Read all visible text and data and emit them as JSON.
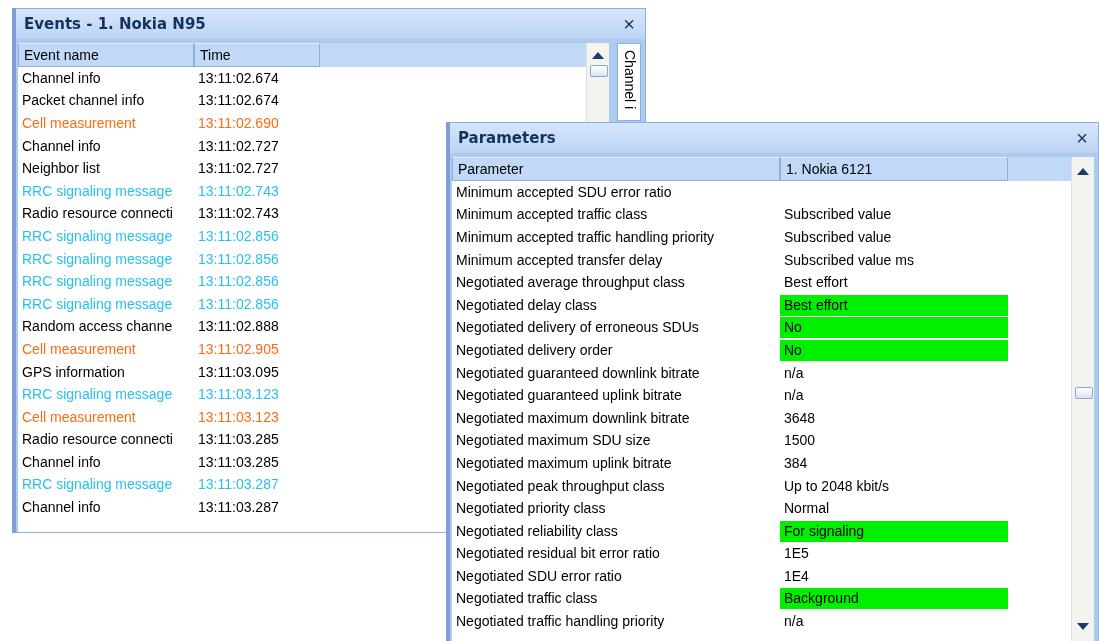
{
  "events_window": {
    "title": "Events - 1. Nokia N95",
    "close": "×",
    "side_tab": "Channel i",
    "columns": [
      "Event name",
      "Time"
    ],
    "rows": [
      {
        "name": "Channel info",
        "time": "13:11:02.674",
        "color": "#000000"
      },
      {
        "name": "Packet channel info",
        "time": "13:11:02.674",
        "color": "#000000"
      },
      {
        "name": "Cell measurement",
        "time": "13:11:02.690",
        "color": "#ff6a13"
      },
      {
        "name": "Channel info",
        "time": "13:11:02.727",
        "color": "#000000"
      },
      {
        "name": "Neighbor list",
        "time": "13:11:02.727",
        "color": "#000000"
      },
      {
        "name": "RRC signaling message",
        "time": "13:11:02.743",
        "color": "#27c0f0"
      },
      {
        "name": "Radio resource connecti",
        "time": "13:11:02.743",
        "color": "#000000"
      },
      {
        "name": "RRC signaling message",
        "time": "13:11:02.856",
        "color": "#27c0f0"
      },
      {
        "name": "RRC signaling message",
        "time": "13:11:02.856",
        "color": "#27c0f0"
      },
      {
        "name": "RRC signaling message",
        "time": "13:11:02.856",
        "color": "#27c0f0"
      },
      {
        "name": "RRC signaling message",
        "time": "13:11:02.856",
        "color": "#27c0f0"
      },
      {
        "name": "Random access channe",
        "time": "13:11:02.888",
        "color": "#000000"
      },
      {
        "name": "Cell measurement",
        "time": "13:11:02.905",
        "color": "#ff6a13"
      },
      {
        "name": "GPS information",
        "time": "13:11:03.095",
        "color": "#000000"
      },
      {
        "name": "RRC signaling message",
        "time": "13:11:03.123",
        "color": "#27c0f0"
      },
      {
        "name": "Cell measurement",
        "time": "13:11:03.123",
        "color": "#ff6a13"
      },
      {
        "name": "Radio resource connecti",
        "time": "13:11:03.285",
        "color": "#000000"
      },
      {
        "name": "Channel info",
        "time": "13:11:03.285",
        "color": "#000000"
      },
      {
        "name": "RRC signaling message",
        "time": "13:11:03.287",
        "color": "#27c0f0"
      },
      {
        "name": "Channel info",
        "time": "13:11:03.287",
        "color": "#000000"
      }
    ]
  },
  "parameters_window": {
    "title": "Parameters",
    "close": "×",
    "columns": [
      "Parameter",
      "1. Nokia 6121"
    ],
    "rows": [
      {
        "parameter": "Minimum accepted SDU error ratio",
        "highlighted": false
      },
      {
        "parameter": "Minimum accepted traffic class",
        "value": "Subscribed value",
        "highlighted": false
      },
      {
        "parameter": "Minimum accepted traffic handling priority",
        "value": "Subscribed value",
        "highlighted": false
      },
      {
        "parameter": "Minimum accepted transfer delay",
        "value": "Subscribed value ms",
        "highlighted": false
      },
      {
        "parameter": "Negotiated average throughput class",
        "value": "Best effort",
        "highlighted": false
      },
      {
        "parameter": "Negotiated delay class",
        "value": "Best effort",
        "highlighted": true
      },
      {
        "parameter": "Negotiated delivery of erroneous SDUs",
        "value": "No",
        "highlighted": true
      },
      {
        "parameter": "Negotiated delivery order",
        "value": "No",
        "highlighted": true
      },
      {
        "parameter": "Negotiated guaranteed downlink bitrate",
        "value": "n/a",
        "highlighted": false
      },
      {
        "parameter": "Negotiated guaranteed uplink bitrate",
        "value": "n/a",
        "highlighted": false
      },
      {
        "parameter": "Negotiated maximum downlink bitrate",
        "value": "3648",
        "highlighted": false
      },
      {
        "parameter": "Negotiated maximum SDU size",
        "value": "1500",
        "highlighted": false
      },
      {
        "parameter": "Negotiated maximum uplink bitrate",
        "value": "384",
        "highlighted": false
      },
      {
        "parameter": "Negotiated peak throughput class",
        "value": "Up to 2048 kbit/s",
        "highlighted": false
      },
      {
        "parameter": "Negotiated priority class",
        "value": "Normal",
        "highlighted": false
      },
      {
        "parameter": "Negotiated reliability class",
        "value": "For signaling",
        "highlighted": true
      },
      {
        "parameter": "Negotiated residual bit error ratio",
        "value": "1E5",
        "highlighted": false
      },
      {
        "parameter": "Negotiated SDU error ratio",
        "value": "1E4",
        "highlighted": false
      },
      {
        "parameter": "Negotiated traffic class",
        "value": "Background",
        "highlighted": true
      },
      {
        "parameter": "Negotiated traffic handling priority",
        "value": "n/a",
        "highlighted": false
      }
    ]
  }
}
